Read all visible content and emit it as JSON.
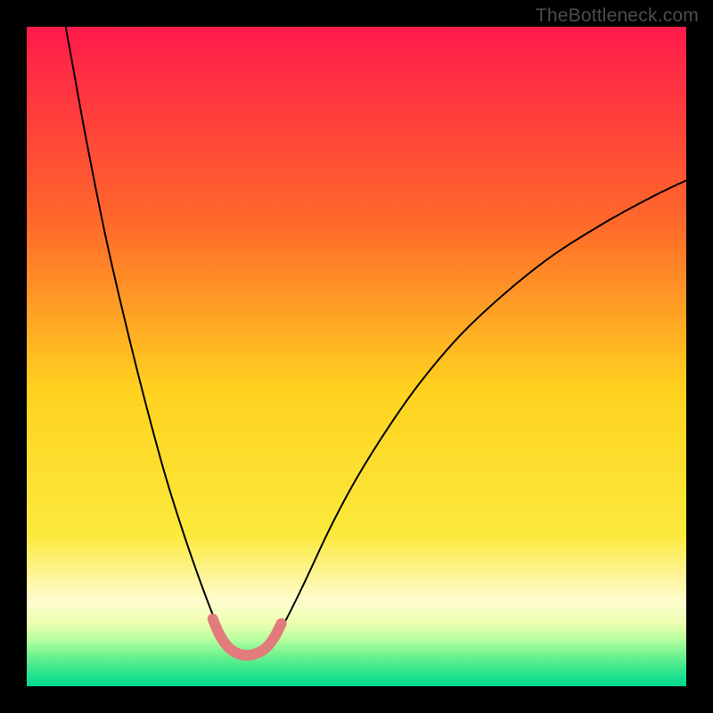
{
  "watermark": "TheBottleneck.com",
  "chart_data": {
    "type": "line",
    "title": "",
    "xlabel": "",
    "ylabel": "",
    "xlim": [
      0,
      100
    ],
    "ylim": [
      0,
      100
    ],
    "grid": false,
    "legend": false,
    "background_gradient_stops": [
      {
        "offset": 0.0,
        "color": "#ff1a4b"
      },
      {
        "offset": 0.3,
        "color": "#ff6a2a"
      },
      {
        "offset": 0.55,
        "color": "#ffd21f"
      },
      {
        "offset": 0.77,
        "color": "#fbe93c"
      },
      {
        "offset": 0.87,
        "color": "#fffccf"
      },
      {
        "offset": 0.905,
        "color": "#ecffb0"
      },
      {
        "offset": 0.93,
        "color": "#b4ff9f"
      },
      {
        "offset": 0.955,
        "color": "#6bf08e"
      },
      {
        "offset": 0.985,
        "color": "#1de28e"
      },
      {
        "offset": 1.0,
        "color": "#00d88f"
      }
    ],
    "series": [
      {
        "name": "bottleneck-curve",
        "stroke": "#000000",
        "stroke_width": 2,
        "points": [
          {
            "x": 5.9,
            "y": 100.0
          },
          {
            "x": 7.0,
            "y": 94.0
          },
          {
            "x": 9.0,
            "y": 83.0
          },
          {
            "x": 12.0,
            "y": 68.0
          },
          {
            "x": 15.0,
            "y": 55.0
          },
          {
            "x": 18.0,
            "y": 43.0
          },
          {
            "x": 21.0,
            "y": 32.0
          },
          {
            "x": 24.0,
            "y": 22.5
          },
          {
            "x": 27.0,
            "y": 14.0
          },
          {
            "x": 29.0,
            "y": 9.0
          },
          {
            "x": 30.5,
            "y": 6.5
          },
          {
            "x": 31.5,
            "y": 5.5
          },
          {
            "x": 32.5,
            "y": 5.0
          },
          {
            "x": 34.0,
            "y": 5.0
          },
          {
            "x": 35.5,
            "y": 5.4
          },
          {
            "x": 37.0,
            "y": 6.5
          },
          {
            "x": 39.0,
            "y": 9.5
          },
          {
            "x": 42.0,
            "y": 15.5
          },
          {
            "x": 46.0,
            "y": 24.0
          },
          {
            "x": 50.0,
            "y": 31.5
          },
          {
            "x": 55.0,
            "y": 39.5
          },
          {
            "x": 60.0,
            "y": 46.5
          },
          {
            "x": 66.0,
            "y": 53.5
          },
          {
            "x": 73.0,
            "y": 60.0
          },
          {
            "x": 80.0,
            "y": 65.5
          },
          {
            "x": 88.0,
            "y": 70.5
          },
          {
            "x": 95.0,
            "y": 74.3
          },
          {
            "x": 100.0,
            "y": 76.7
          }
        ]
      },
      {
        "name": "highlight-dip",
        "stroke": "#e27b7b",
        "stroke_width": 12,
        "linecap": "round",
        "points": [
          {
            "x": 28.2,
            "y": 10.2
          },
          {
            "x": 29.3,
            "y": 7.7
          },
          {
            "x": 30.8,
            "y": 5.7
          },
          {
            "x": 32.5,
            "y": 4.8
          },
          {
            "x": 34.2,
            "y": 4.8
          },
          {
            "x": 36.0,
            "y": 5.6
          },
          {
            "x": 37.4,
            "y": 7.2
          },
          {
            "x": 38.6,
            "y": 9.5
          }
        ]
      }
    ]
  }
}
